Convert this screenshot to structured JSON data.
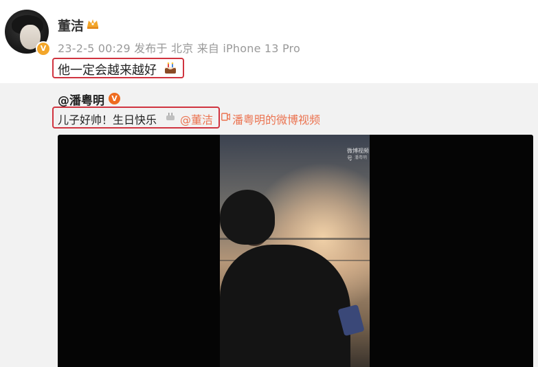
{
  "post": {
    "author_name": "董洁",
    "meta": "23-2-5 00:29 发布于 北京 来自 iPhone 13 Pro",
    "text": "他一定会越来越好",
    "verified_mark": "V"
  },
  "repost": {
    "author": "@潘粤明",
    "badge_mark": "V",
    "text": "儿子好帅！生日快乐",
    "mention": "@董洁",
    "video_link": "潘粤明的微博视频",
    "video_watermark": "微博视频号",
    "video_watermark_sub": "潘粤明"
  },
  "icons": {
    "avatar_badge": "verified-badge",
    "crown": "crown-icon",
    "cake": "cake-icon",
    "video_link": "video-link-icon"
  },
  "colors": {
    "accent": "#eb7350",
    "highlight_box": "#d0333f",
    "meta_text": "#999999",
    "repost_bg": "#f2f2f2",
    "verified_gold": "#f3a62a",
    "verified_orange": "#ef6b1f"
  }
}
